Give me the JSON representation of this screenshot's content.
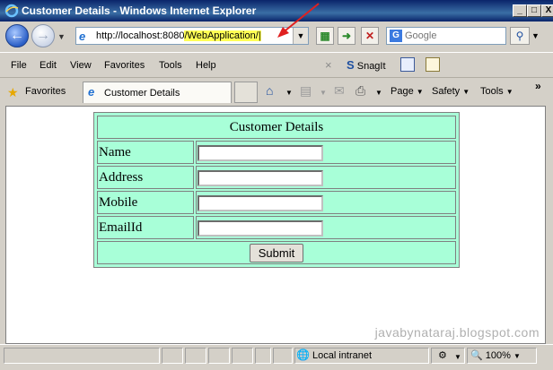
{
  "window": {
    "title": "Customer Details - Windows Internet Explorer",
    "controls": [
      "_",
      "□",
      "X"
    ]
  },
  "address_bar": {
    "url_base": "http://localhost:8080",
    "url_highlight": "/WebApplication/",
    "url_cursor": "|"
  },
  "search": {
    "placeholder": "Google",
    "provider_icon": "G"
  },
  "menu": {
    "items": [
      "File",
      "Edit",
      "View",
      "Favorites",
      "Tools",
      "Help"
    ],
    "snagit_label": "SnagIt"
  },
  "favorites_bar": {
    "favorites_label": "Favorites",
    "tab_label": "Customer Details",
    "page_label": "Page",
    "safety_label": "Safety",
    "tools_label": "Tools"
  },
  "form": {
    "heading": "Customer Details",
    "fields": [
      {
        "label": "Name",
        "value": ""
      },
      {
        "label": "Address",
        "value": ""
      },
      {
        "label": "Mobile",
        "value": ""
      },
      {
        "label": "EmailId",
        "value": ""
      }
    ],
    "submit_label": "Submit"
  },
  "watermark": "javabynataraj.blogspot.com",
  "status_bar": {
    "zone_label": "Local intranet",
    "zoom_label": "100%"
  },
  "colors": {
    "form_background": "#a8ffd8",
    "url_highlight": "#ffff55",
    "arrow": "#e02020"
  }
}
